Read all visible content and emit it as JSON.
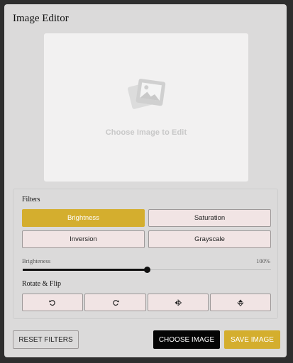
{
  "app": {
    "title": "Image Editor"
  },
  "preview": {
    "placeholder_text": "Choose Image to Edit",
    "placeholder_icon": "image-placeholder-icon"
  },
  "filters": {
    "section_label": "Filters",
    "buttons": [
      {
        "label": "Brightness",
        "active": true
      },
      {
        "label": "Saturation",
        "active": false
      },
      {
        "label": "Inversion",
        "active": false
      },
      {
        "label": "Grayscale",
        "active": false
      }
    ],
    "slider": {
      "name": "Brighteness",
      "value_text": "100%",
      "level": 1.0
    }
  },
  "rotate_flip": {
    "section_label": "Rotate & Flip",
    "icons": [
      "rotate-left-icon",
      "rotate-right-icon",
      "flip-horizontal-icon",
      "flip-vertical-icon"
    ]
  },
  "footer": {
    "reset_label": "RESET FILTERS",
    "choose_label": "CHOOSE IMAGE",
    "save_label": "SAVE IMAGE"
  },
  "colors": {
    "accent": "#d4ae2e",
    "button_bg": "#f1e4e4",
    "panel_bg": "#dbdada"
  }
}
